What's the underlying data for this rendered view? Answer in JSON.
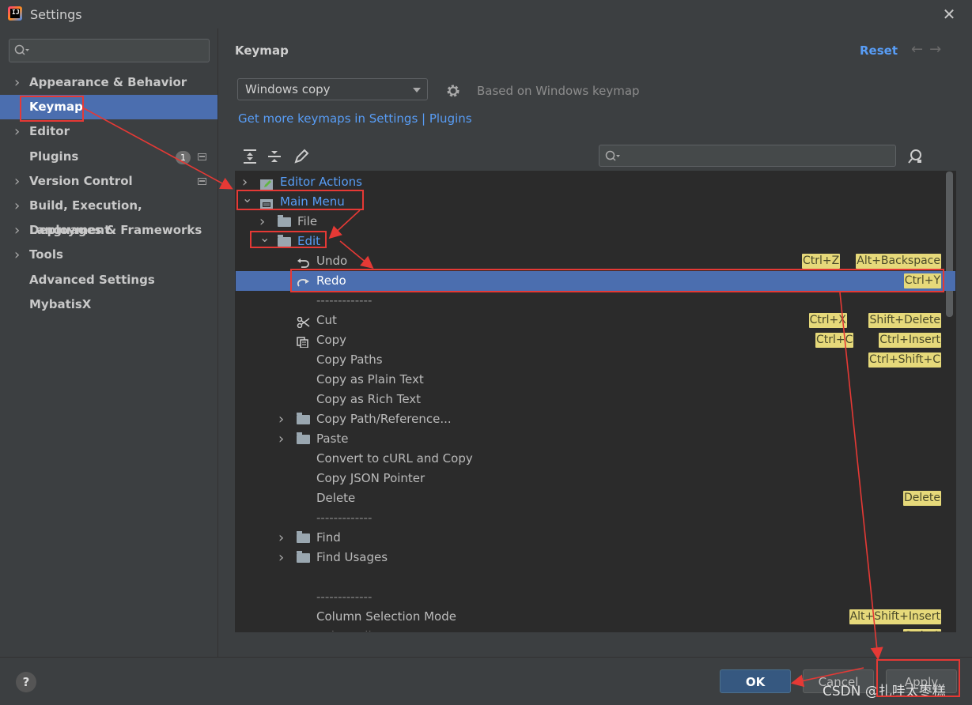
{
  "window": {
    "title": "Settings",
    "close_glyph": "✕"
  },
  "sidebar": {
    "items": [
      {
        "label": "Appearance & Behavior",
        "expandable": true
      },
      {
        "label": "Keymap",
        "selected": true
      },
      {
        "label": "Editor",
        "expandable": true
      },
      {
        "label": "Plugins",
        "badge": "1"
      },
      {
        "label": "Version Control",
        "expandable": true
      },
      {
        "label": "Build, Execution, Deployment",
        "expandable": true
      },
      {
        "label": "Languages & Frameworks",
        "expandable": true
      },
      {
        "label": "Tools",
        "expandable": true
      },
      {
        "label": "Advanced Settings"
      },
      {
        "label": "MybatisX"
      }
    ]
  },
  "header": {
    "breadcrumb": "Keymap",
    "reset_label": "Reset",
    "back_glyph": "←",
    "forward_glyph": "→"
  },
  "keymap": {
    "scheme": "Windows copy",
    "based_on": "Based on Windows keymap",
    "more_link": "Get more keymaps in Settings | Plugins"
  },
  "tree": {
    "rows": [
      {
        "label": "Editor Actions",
        "arrow": "right",
        "icon": "editor-actions-icon",
        "blue": true,
        "shortcuts": []
      },
      {
        "label": "Main Menu",
        "arrow": "down",
        "icon": "main-menu-icon",
        "blue": true,
        "shortcuts": []
      },
      {
        "label": "File",
        "arrow": "right",
        "icon": "folder-icon",
        "shortcuts": []
      },
      {
        "label": "Edit",
        "arrow": "down",
        "icon": "folder-icon",
        "blue": true,
        "shortcuts": []
      },
      {
        "label": "Undo",
        "icon": "undo-icon",
        "shortcuts": [
          "Ctrl+Z",
          "Alt+Backspace"
        ]
      },
      {
        "label": "Redo",
        "icon": "redo-icon",
        "selected": true,
        "shortcuts": [
          "Ctrl+Y"
        ]
      },
      {
        "label": "-------------",
        "shortcuts": []
      },
      {
        "label": "Cut",
        "icon": "scissors-icon",
        "shortcuts": [
          "Ctrl+X",
          "Shift+Delete"
        ]
      },
      {
        "label": "Copy",
        "icon": "copy-icon",
        "shortcuts": [
          "Ctrl+C",
          "Ctrl+Insert"
        ]
      },
      {
        "label": "Copy Paths",
        "shortcuts": [
          "Ctrl+Shift+C"
        ]
      },
      {
        "label": "Copy as Plain Text",
        "shortcuts": []
      },
      {
        "label": "Copy as Rich Text",
        "shortcuts": []
      },
      {
        "label": "Copy Path/Reference...",
        "arrow": "right",
        "icon": "folder-icon",
        "shortcuts": []
      },
      {
        "label": "Paste",
        "arrow": "right",
        "icon": "folder-icon",
        "shortcuts": []
      },
      {
        "label": "Convert to cURL and Copy",
        "shortcuts": []
      },
      {
        "label": "Copy JSON Pointer",
        "shortcuts": []
      },
      {
        "label": "Delete",
        "shortcuts": [
          "Delete"
        ]
      },
      {
        "label": "-------------",
        "shortcuts": []
      },
      {
        "label": "Find",
        "arrow": "right",
        "icon": "folder-icon",
        "shortcuts": []
      },
      {
        "label": "Find Usages",
        "arrow": "right",
        "icon": "folder-icon",
        "shortcuts": []
      },
      {
        "label": "",
        "shortcuts": []
      },
      {
        "label": "-------------",
        "shortcuts": []
      },
      {
        "label": "Column Selection Mode",
        "shortcuts": [
          "Alt+Shift+Insert"
        ]
      },
      {
        "label": "Select All",
        "shortcuts": [
          "Ctrl+A"
        ]
      }
    ]
  },
  "footer": {
    "help_glyph": "?",
    "ok_label": "OK",
    "cancel_label": "Cancel",
    "apply_label": "Apply",
    "watermark": "CSDN @扎哇太枣糕"
  },
  "colors": {
    "accent": "#4b6eaf",
    "link": "#589df6",
    "annotation": "#e53935",
    "shortcut_bg": "#e6d97a"
  }
}
